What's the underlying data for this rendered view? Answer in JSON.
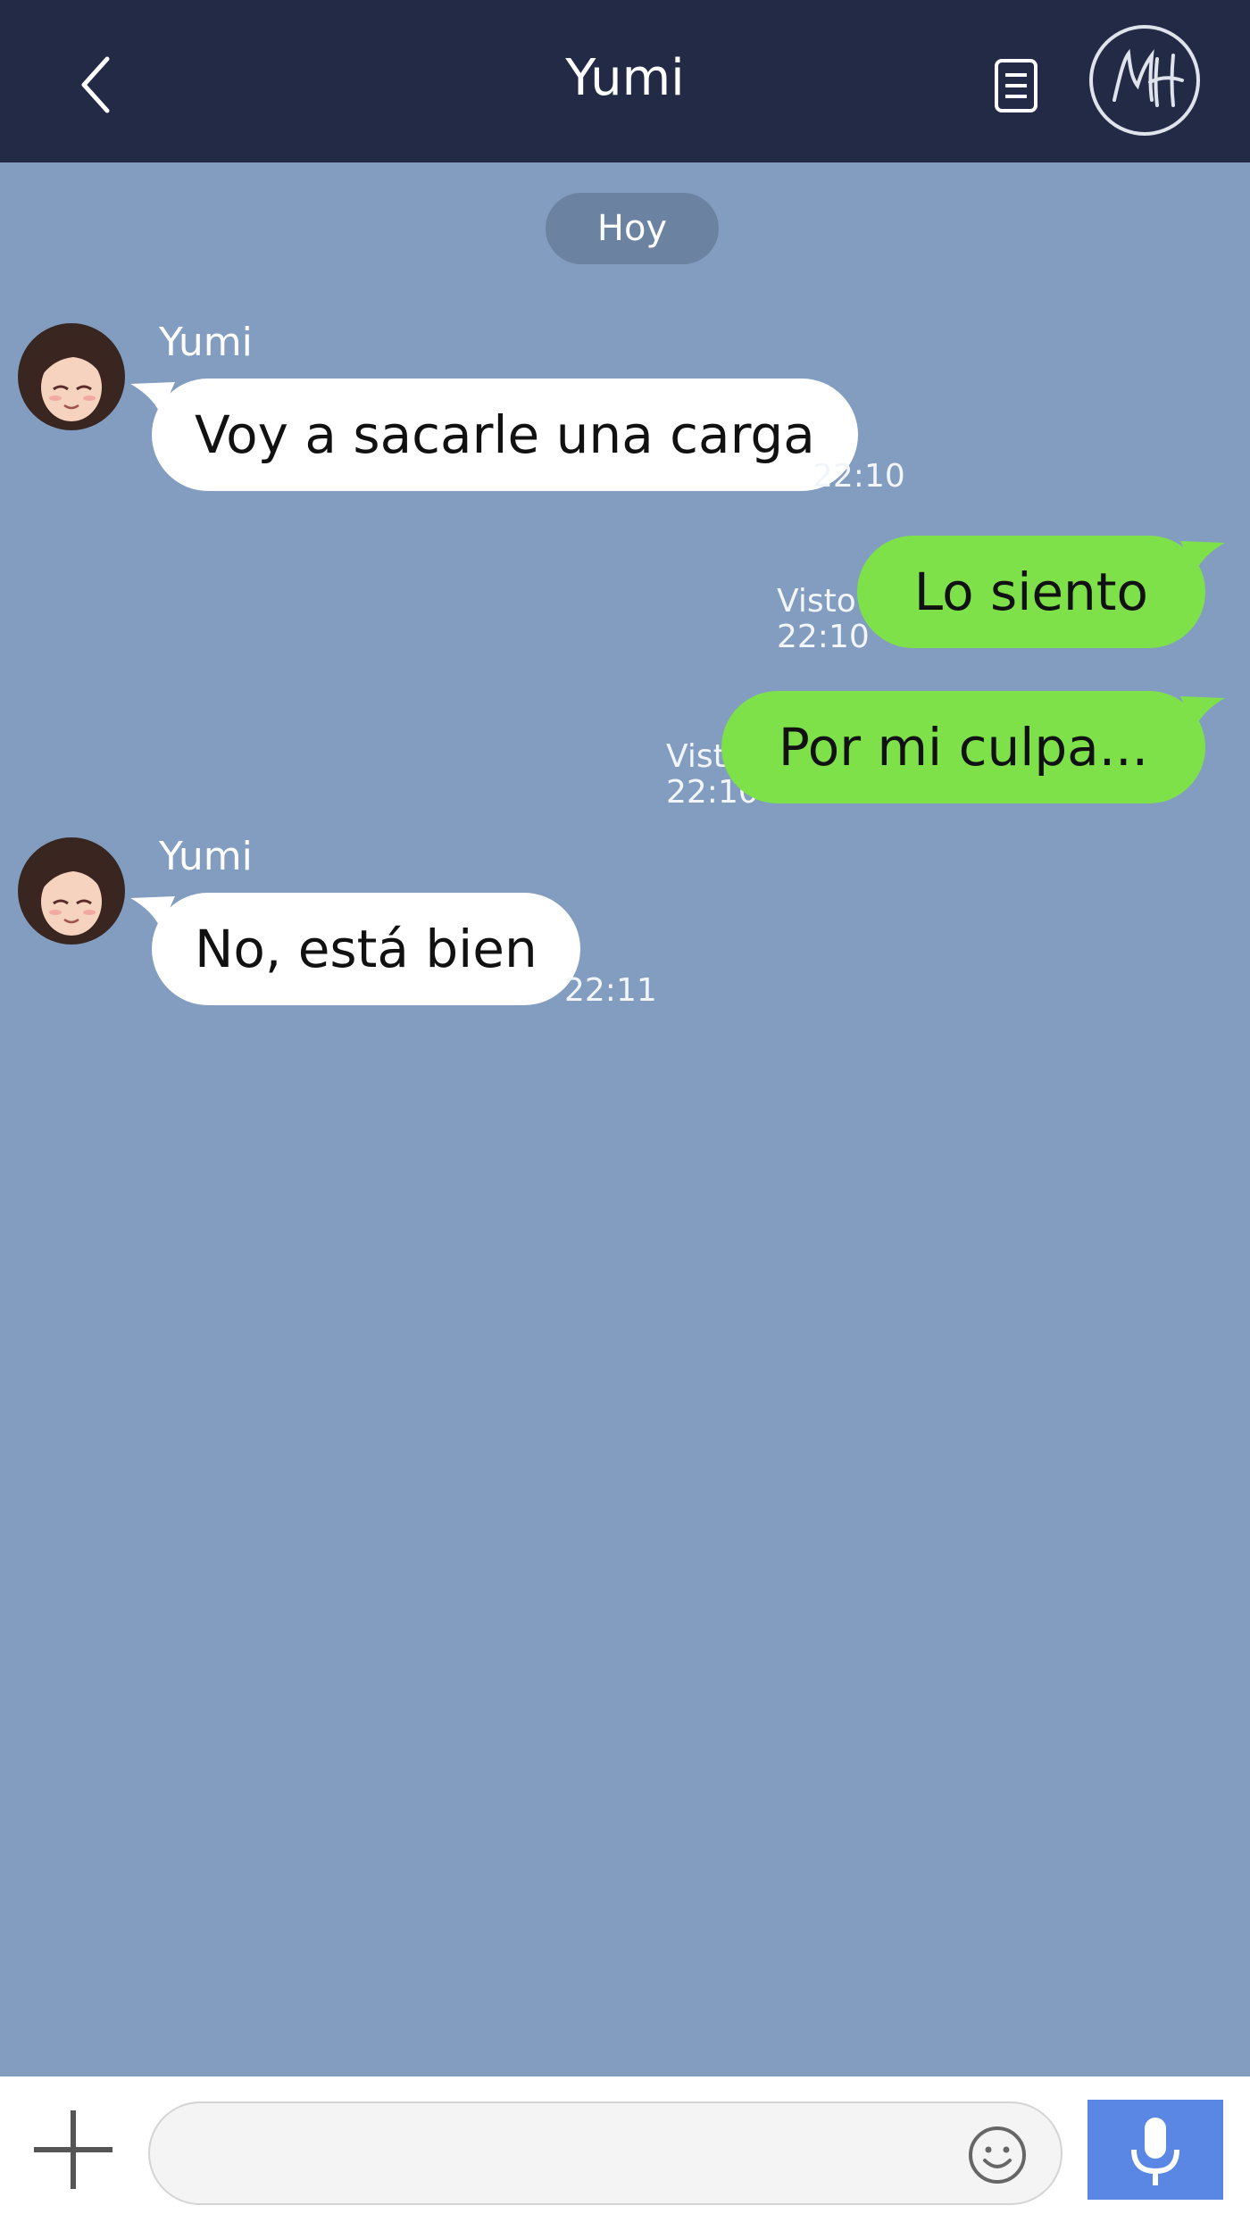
{
  "header": {
    "title": "Yumi",
    "back_icon": "chevron-left-icon",
    "notes_icon": "document-list-icon",
    "logo_text": "MH"
  },
  "date_divider": "Hoy",
  "messages": [
    {
      "direction": "incoming",
      "sender": "Yumi",
      "text": "Voy a sacarle una carga",
      "time": "22:10"
    },
    {
      "direction": "outgoing",
      "status": "Visto",
      "text": "Lo siento",
      "time": "22:10"
    },
    {
      "direction": "outgoing",
      "status": "Visto",
      "text": "Por mi culpa...",
      "time": "22:10"
    },
    {
      "direction": "incoming",
      "sender": "Yumi",
      "text": "No, está bien",
      "time": "22:11"
    }
  ],
  "composer": {
    "value": "",
    "plus_icon": "plus-icon",
    "emoji_icon": "smiley-icon",
    "mic_icon": "microphone-icon"
  },
  "colors": {
    "header_bg": "#222a45",
    "chat_bg": "#829dbf",
    "incoming_bubble": "#ffffff",
    "outgoing_bubble": "#7fe14a",
    "mic_button": "#5b87e4"
  }
}
